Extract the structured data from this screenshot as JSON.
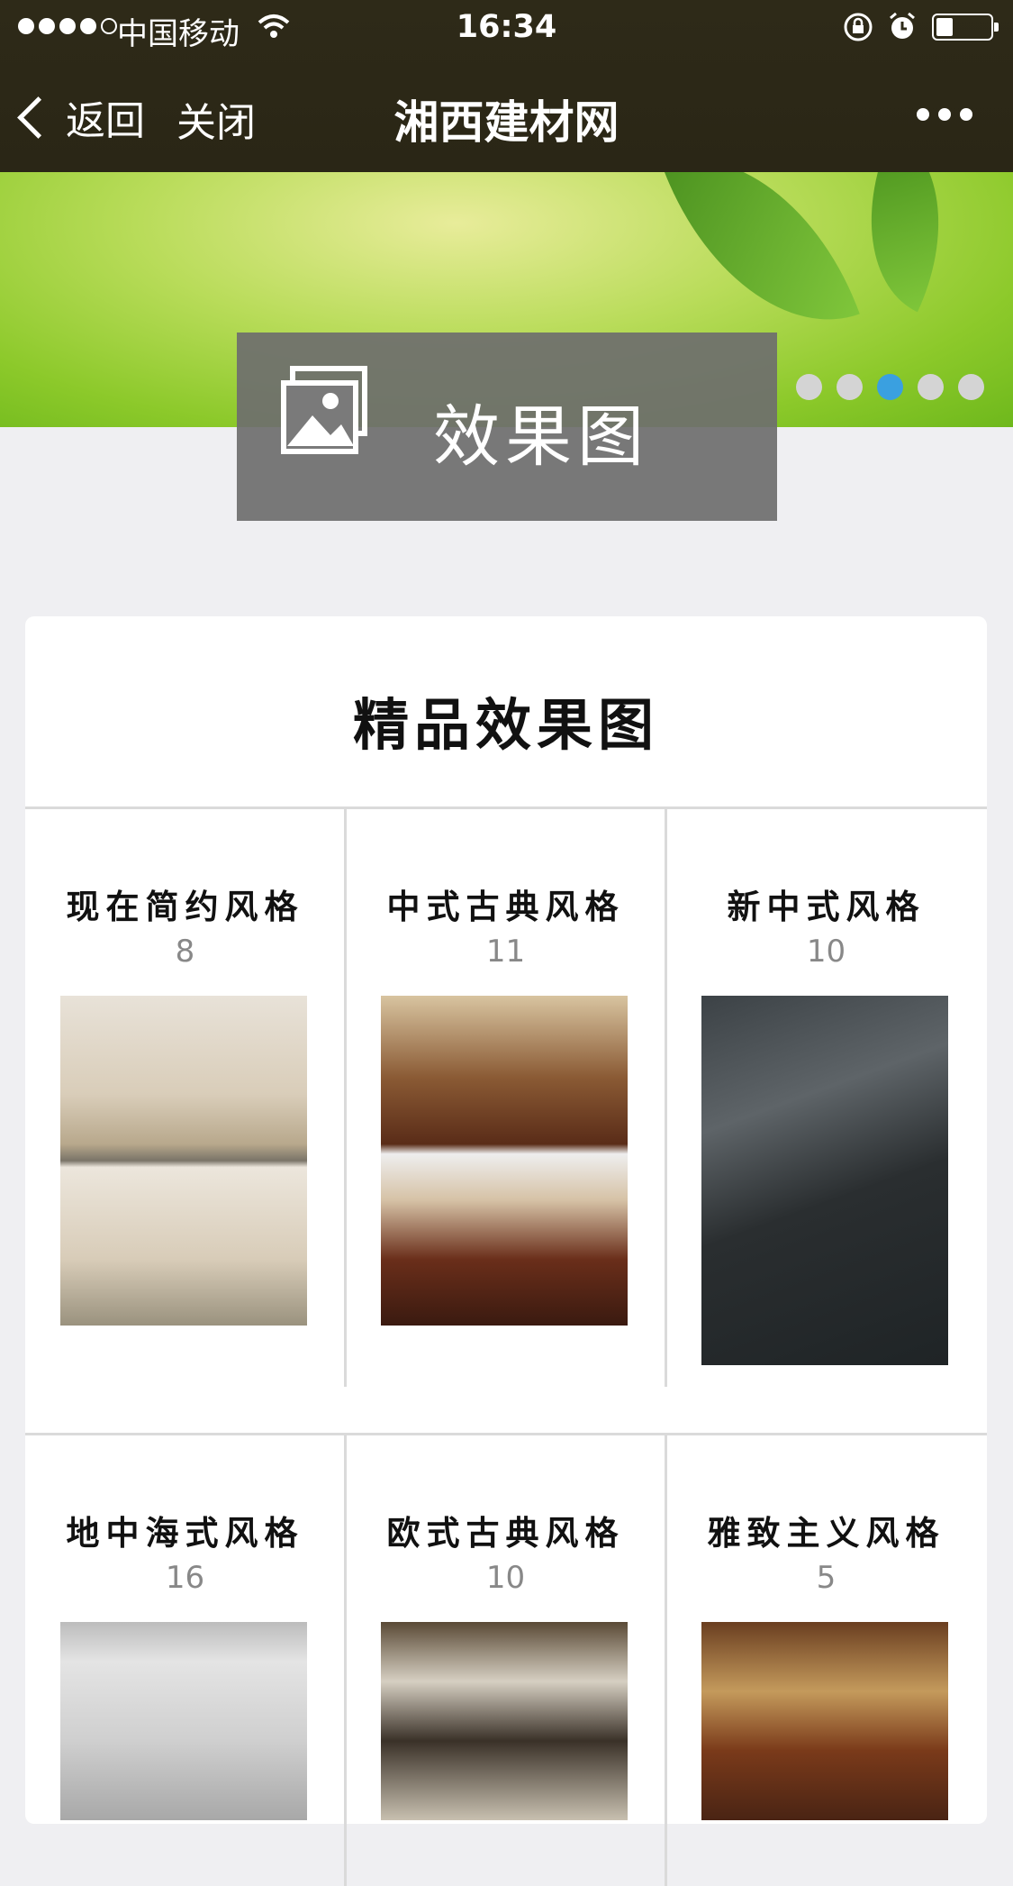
{
  "status": {
    "carrier": "中国移动",
    "time": "16:34"
  },
  "nav": {
    "back_label": "返回",
    "close_label": "关闭",
    "title": "湘西建材网"
  },
  "banner": {
    "slide_count": 5,
    "active_slide": 3
  },
  "hero": {
    "label": "效果图"
  },
  "section": {
    "title": "精品效果图",
    "categories": [
      {
        "name": "现在简约风格",
        "count": "8"
      },
      {
        "name": "中式古典风格",
        "count": "11"
      },
      {
        "name": "新中式风格",
        "count": "10"
      },
      {
        "name": "地中海式风格",
        "count": "16"
      },
      {
        "name": "欧式古典风格",
        "count": "10"
      },
      {
        "name": "雅致主义风格",
        "count": "5"
      }
    ]
  },
  "colors": {
    "topbar": "#2e2a18",
    "active_dot": "#3aa0e0"
  }
}
